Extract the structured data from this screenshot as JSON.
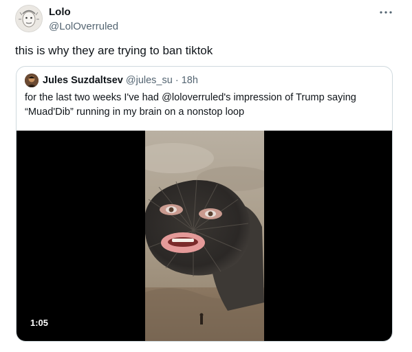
{
  "tweet": {
    "author_name": "Lolo",
    "author_handle": "@LolOverruled",
    "more_icon": "more-horizontal-icon",
    "text": "this is why they are trying to ban tiktok"
  },
  "quote": {
    "author_name": "Jules Suzdaltsev",
    "author_handle": "@jules_su",
    "separator": "·",
    "time": "18h",
    "text": "for the last two weeks I've had @loloverruled's impression of Trump saying “Muad'Dib” running in my brain on a nonstop loop",
    "media": {
      "type": "video",
      "duration": "1:05",
      "subject": "sandworm-face-video-frame"
    }
  },
  "colors": {
    "text_primary": "#0f1419",
    "text_secondary": "#536471",
    "border": "#cfd9de",
    "background": "#ffffff"
  }
}
